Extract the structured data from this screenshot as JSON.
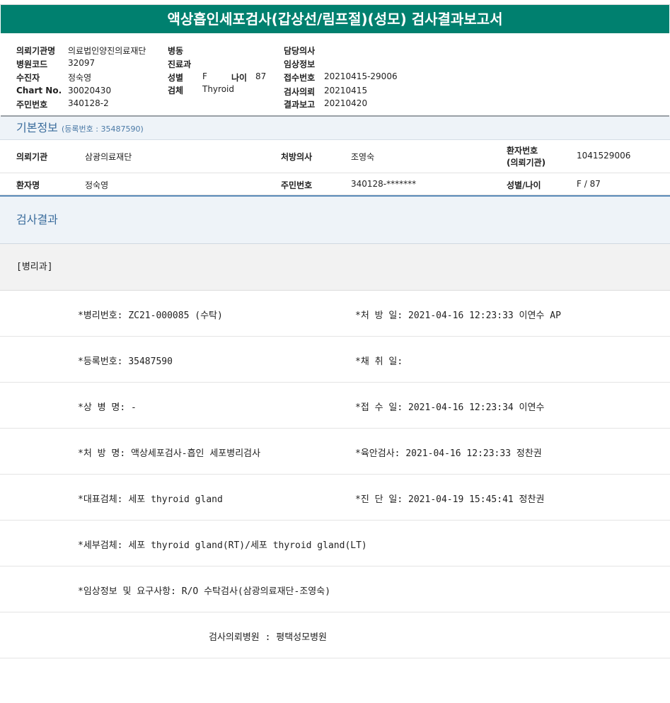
{
  "title": "액상흡인세포검사(갑상선/림프절)(성모) 검사결과보고서",
  "info": {
    "col1": [
      {
        "label": "의뢰기관명",
        "value": "의료법인양진의료재단"
      },
      {
        "label": "병원코드",
        "value": "32097"
      },
      {
        "label": "수진자",
        "value": "정숙영"
      },
      {
        "label": "Chart No.",
        "value": "30020430"
      },
      {
        "label": "주민번호",
        "value": "340128-2"
      }
    ],
    "col2": [
      {
        "label": "병동",
        "value": ""
      },
      {
        "label": "진료과",
        "value": ""
      },
      {
        "label": "성별",
        "value": "F"
      },
      {
        "label": "검체",
        "value": "Thyroid"
      }
    ],
    "age_label": "나이",
    "age_value": "87",
    "col3": [
      {
        "label": "담당의사",
        "value": ""
      },
      {
        "label": "임상정보",
        "value": ""
      },
      {
        "label": "접수번호",
        "value": "20210415-29006"
      },
      {
        "label": "검사의뢰",
        "value": "20210415"
      },
      {
        "label": "결과보고",
        "value": "20210420"
      }
    ]
  },
  "basic": {
    "title": "기본정보",
    "sub": "(등록번호 : 35487590)",
    "row1": {
      "k1": "의뢰기관",
      "v1": "삼광의료재단",
      "k2": "처방의사",
      "v2": "조영숙",
      "k3a": "환자번호",
      "k3b": "(의뢰기관)",
      "v3": "1041529006"
    },
    "row2": {
      "k1": "환자명",
      "v1": "정숙영",
      "k2": "주민번호",
      "v2": "340128-*******",
      "k3": "성별/나이",
      "v3": "F / 87"
    }
  },
  "results": {
    "title": "검사결과",
    "section": "[병리과]",
    "rows": [
      {
        "left": "*병리번호: ZC21-000085 (수탁)",
        "right": "*처 방 일: 2021-04-16 12:23:33  이연수 AP"
      },
      {
        "left": "*등록번호: 35487590",
        "right": "*채 취 일:"
      },
      {
        "left": "*상 병 명: -",
        "right": "*접 수 일: 2021-04-16 12:23:34  이연수"
      },
      {
        "left": "*처 방 명: 액상세포검사-흡인 세포병리검사",
        "right": "*육안검사: 2021-04-16 12:23:33  정찬권"
      },
      {
        "left": "*대표검체: 세포 thyroid gland",
        "right": "*진 단 일: 2021-04-19 15:45:41  정찬권"
      },
      {
        "left": "*세부검체: 세포 thyroid gland(RT)/세포 thyroid gland(LT)",
        "right": ""
      },
      {
        "left": "*임상정보 및 요구사항: R/O 수탁검사(삼광의료재단-조영숙)",
        "right": ""
      }
    ],
    "hospital": "검사의뢰병원  : 평택성모병원"
  }
}
